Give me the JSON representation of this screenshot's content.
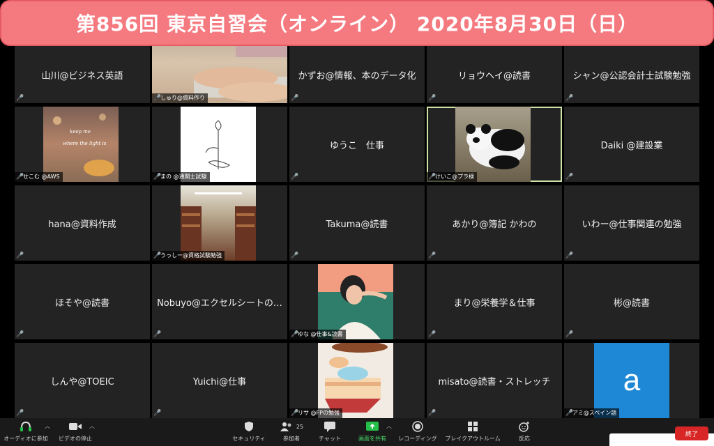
{
  "banner": {
    "title": "第856回 東京自習会（オンライン） 2020年8月30日（日）"
  },
  "tiles": [
    {
      "name": "山川@ビジネス英語"
    },
    {
      "name": "しゅり@資料作り"
    },
    {
      "name": "かずお@情報、本のデータ化"
    },
    {
      "name": "リョウヘイ@読書"
    },
    {
      "name": "シャン@公認会計士試験勉強"
    },
    {
      "name": "せこむ @AWS",
      "image_text": "keep me where the light is"
    },
    {
      "name": "まの @通関士試験"
    },
    {
      "name": "ゆうこ　仕事"
    },
    {
      "name": "けいこ@プラ検"
    },
    {
      "name": "Daiki @建設業"
    },
    {
      "name": "hana@資料作成"
    },
    {
      "name": "うっしー@資格試験勉強"
    },
    {
      "name": "Takuma@読書"
    },
    {
      "name": "あかり@簿記 かわの"
    },
    {
      "name": "いわー@仕事関連の勉強"
    },
    {
      "name": "ほそや@読書"
    },
    {
      "name": "Nobuyo@エクセルシートの…"
    },
    {
      "name": "ゆな @仕事&読書"
    },
    {
      "name": "まり@栄養学＆仕事"
    },
    {
      "name": "彬@読書"
    },
    {
      "name": "しんや@TOEIC"
    },
    {
      "name": "Yuichi@仕事"
    },
    {
      "name": "リサ @FPの勉強"
    },
    {
      "name": "misato@読書・ストレッチ"
    },
    {
      "name": "アミ@スペイン語",
      "avatar_letter": "a"
    }
  ],
  "toolbar": {
    "audio": "オーディオに参加",
    "video": "ビデオの停止",
    "security": "セキュリティ",
    "participants": "参加者",
    "participants_count": "25",
    "chat": "チャット",
    "share": "画面を共有",
    "record": "レコーディング",
    "breakout": "ブレイクアウトルーム",
    "reactions": "反応",
    "end": "終了"
  },
  "colors": {
    "banner": "#f47a80",
    "share_green": "#25c04a",
    "end_red": "#d82626",
    "active_outline": "#cfe3a6",
    "avatar_blue": "#1e88d6"
  }
}
